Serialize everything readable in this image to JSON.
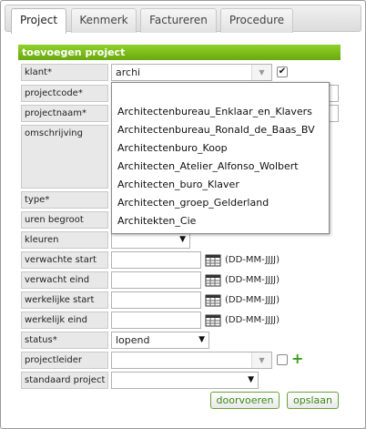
{
  "tabs": [
    {
      "label": "Project"
    },
    {
      "label": "Kenmerk"
    },
    {
      "label": "Factureren"
    },
    {
      "label": "Procedure"
    }
  ],
  "form": {
    "title": "toevoegen project",
    "labels": {
      "klant": "klant*",
      "projectcode": "projectcode*",
      "projectnaam": "projectnaam*",
      "omschrijving": "omschrijving",
      "type": "type*",
      "uren_begroot": "uren begroot",
      "kleuren": "kleuren",
      "verwachte_start": "verwachte start",
      "verwacht_eind": "verwacht eind",
      "werkelijke_start": "werkelijke start",
      "werkelijk_eind": "werkelijk eind",
      "status": "status*",
      "projectleider": "projectleider",
      "standaard_project": "standaard project"
    },
    "klant_value": "archi",
    "status_value": "lopend",
    "date_hint": "(DD-MM-JJJJ)",
    "buttons": {
      "doorvoeren": "doorvoeren",
      "opslaan": "opslaan"
    }
  },
  "dropdown_items": [
    "Architectenbureau_Enklaar_en_Klavers",
    "Architectenbureau_Ronald_de_Baas_BV",
    "Architectenburo_Koop",
    "Architecten_Atelier_Alfonso_Wolbert",
    "Architecten_buro_Klaver",
    "Architecten_groep_Gelderland",
    "Architekten_Cie"
  ],
  "colors": {
    "header_green": "#7cbd1d",
    "button_text": "#3a8a1a"
  }
}
